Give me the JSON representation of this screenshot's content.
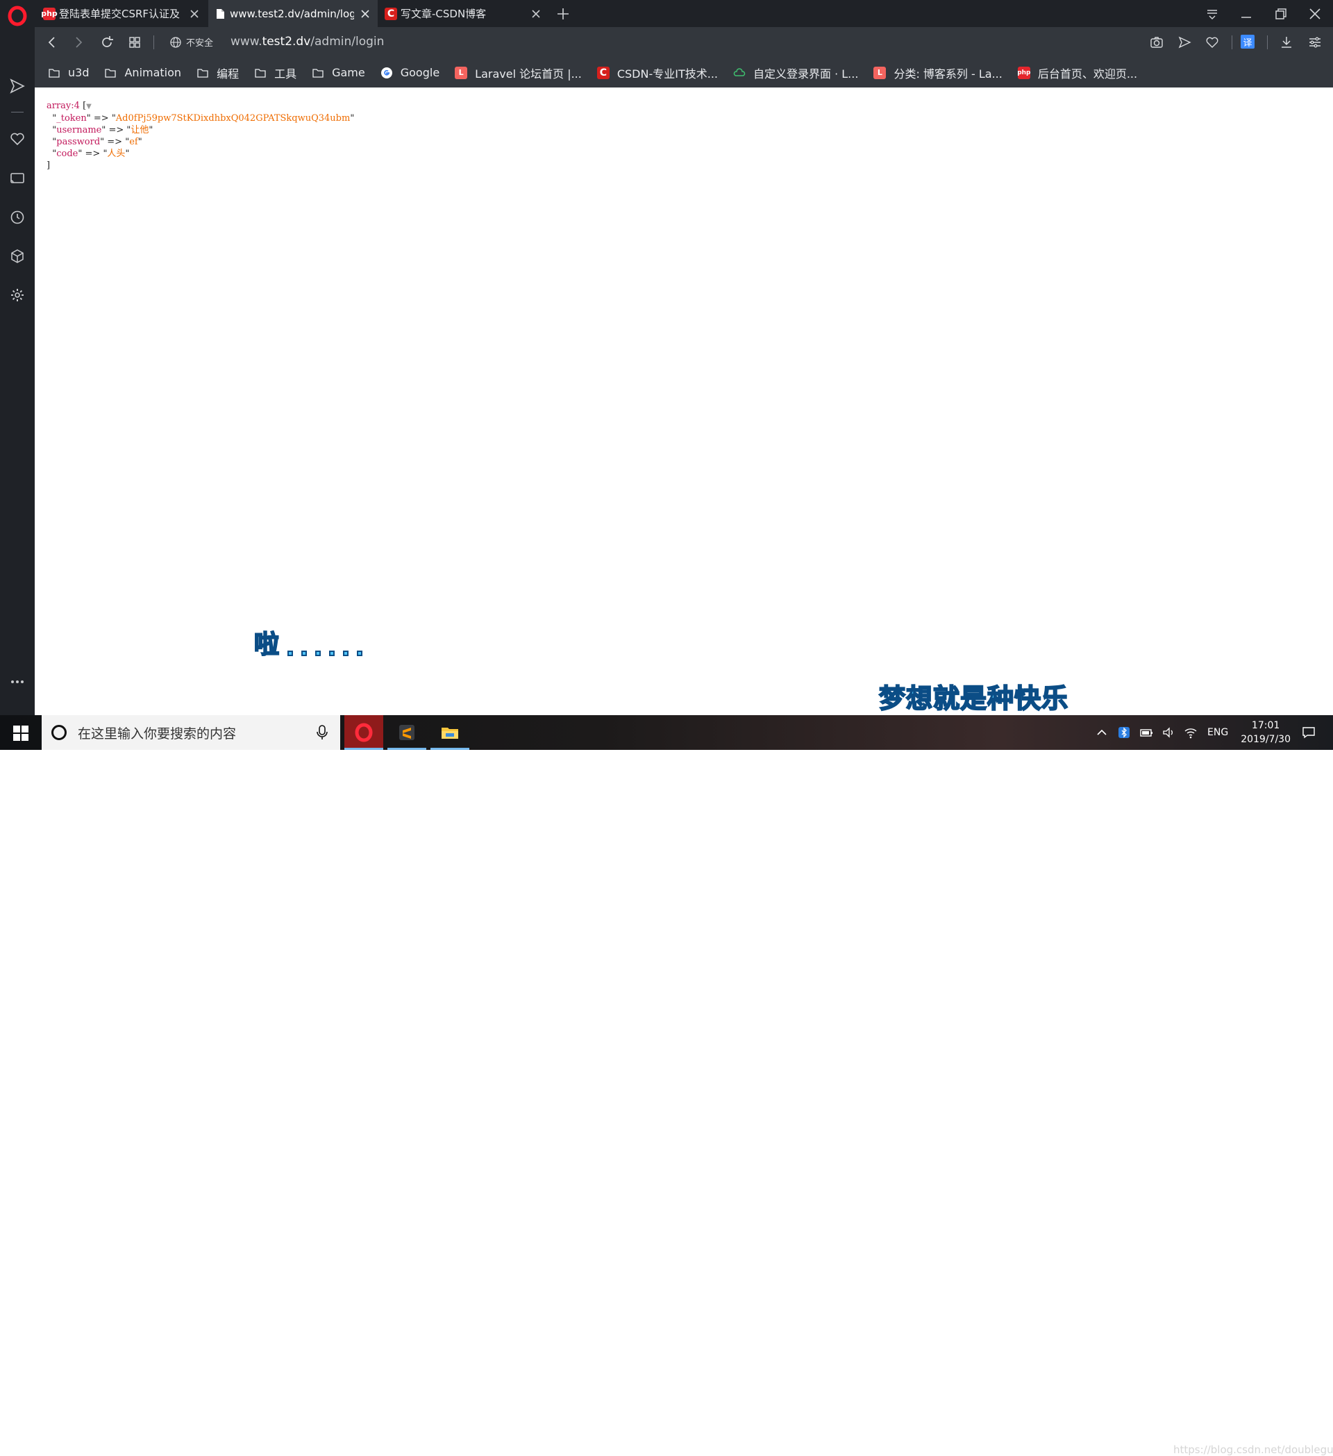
{
  "tabs": [
    {
      "title": "登陆表单提交CSRF认证及",
      "favicon": "php",
      "favicon_color": "#e5262d",
      "active": false
    },
    {
      "title": "www.test2.dv/admin/log",
      "favicon": "page",
      "favicon_color": "#ffffff",
      "active": true
    },
    {
      "title": "写文章-CSDN博客",
      "favicon": "C",
      "favicon_color": "#d6201d",
      "active": false
    }
  ],
  "address": {
    "security_label": "不安全",
    "url_prefix": "www.",
    "url_host": "test2.dv",
    "url_path": "/admin/login"
  },
  "bookmarks": [
    {
      "label": "u3d",
      "icon": "folder-icon"
    },
    {
      "label": "Animation",
      "icon": "folder-icon"
    },
    {
      "label": "编程",
      "icon": "folder-icon"
    },
    {
      "label": "工具",
      "icon": "folder-icon"
    },
    {
      "label": "Game",
      "icon": "folder-icon"
    },
    {
      "label": "Google",
      "icon": "google-icon"
    },
    {
      "label": "Laravel 论坛首页 |...",
      "icon": "laravel-icon"
    },
    {
      "label": "CSDN-专业IT技术...",
      "icon": "csdn-icon"
    },
    {
      "label": "自定义登录界面 · L...",
      "icon": "cloud-icon"
    },
    {
      "label": "分类: 博客系列 - La...",
      "icon": "laravel-icon"
    },
    {
      "label": "后台首页、欢迎页...",
      "icon": "php-icon"
    }
  ],
  "dump": {
    "header": "array:4",
    "open": "[",
    "toggle": "▼",
    "entries": [
      {
        "key": "_token",
        "value": "Ad0fPj59pw7StKDixdhbxQ042GPATSkqwuQ34ubm"
      },
      {
        "key": "username",
        "value": "让他"
      },
      {
        "key": "password",
        "value": "ef"
      },
      {
        "key": "code",
        "value": "人头"
      }
    ],
    "arrow": "=>",
    "close": "]"
  },
  "subtitles": {
    "line1": "啦",
    "line2": "梦想就是种快乐"
  },
  "taskbar": {
    "search_placeholder": "在这里输入你要搜索的内容",
    "lang": "ENG",
    "time": "17:01",
    "date": "2019/7/30"
  },
  "watermark": "https://blog.csdn.net/doubleguy",
  "colors": {
    "browser_dark": "#1f2227",
    "toolbar": "#33373d",
    "dump_key": "#c2185b",
    "dump_string": "#ef6c00",
    "subtitle_fill": "#4fc3f7",
    "subtitle_stroke": "#0b4d86"
  }
}
